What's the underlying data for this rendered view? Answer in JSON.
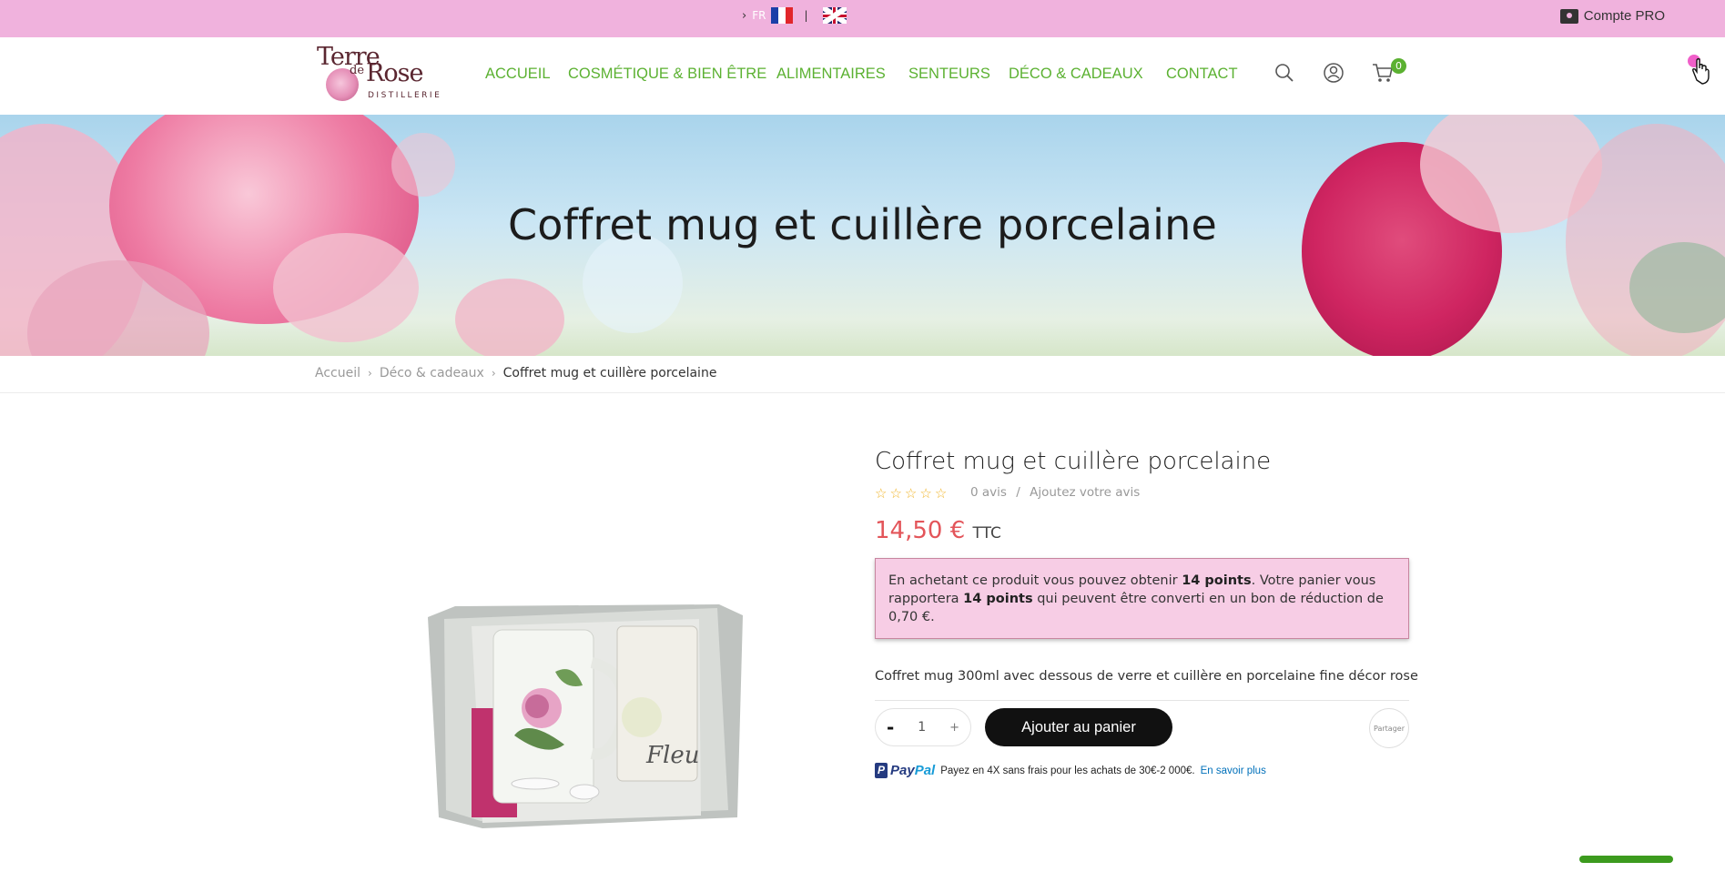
{
  "topbar": {
    "lang_code": "FR",
    "lang_separator": "|",
    "pro_account": "Compte PRO"
  },
  "header": {
    "logo": "Terre de Rose Distillerie",
    "nav": [
      "ACCUEIL",
      "COSMÉTIQUE & BIEN ÊTRE",
      "ALIMENTAIRES",
      "SENTEURS",
      "DÉCO & CADEAUX",
      "CONTACT"
    ],
    "cart_count": "0"
  },
  "banner": {
    "title": "Coffret mug et cuillère porcelaine"
  },
  "breadcrumb": {
    "items": [
      "Accueil",
      "Déco & cadeaux",
      "Coffret mug et cuillère porcelaine"
    ]
  },
  "product": {
    "title": "Coffret mug et cuillère porcelaine",
    "rating_stars": 0,
    "reviews_count": "0 avis",
    "reviews_sep": "/",
    "add_review": "Ajoutez votre avis",
    "price": "14,50 €",
    "price_suffix": "TTC",
    "loyalty": {
      "part1": "En achetant ce produit vous pouvez obtenir ",
      "points1": "14 points",
      "part2": ". Votre panier vous rapportera ",
      "points2": "14 points",
      "part3": " qui peuvent être converti en un bon de réduction de 0,70 €."
    },
    "description": "Coffret mug 300ml avec dessous de verre et cuillère en porcelaine fine décor rose",
    "qty_minus": "-",
    "qty_value": "1",
    "qty_plus": "+",
    "add_to_cart": "Ajouter au panier",
    "share": "Partager",
    "paypal_brand_1": "Pay",
    "paypal_brand_2": "Pal",
    "paypal_text": "Payez en 4X sans frais pour les achats de 30€-2 000€.",
    "paypal_more": "En savoir plus"
  }
}
